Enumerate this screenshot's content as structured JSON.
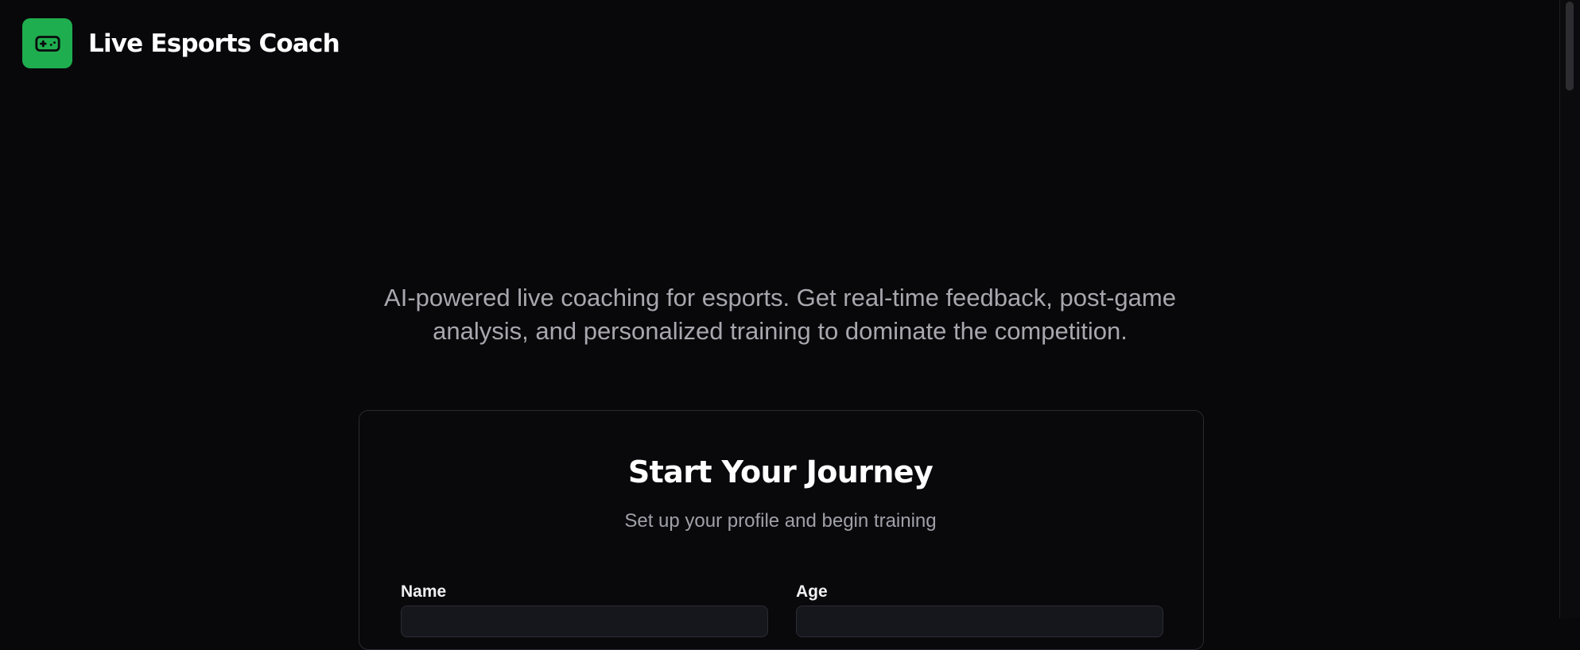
{
  "header": {
    "logo_icon": "gamepad-icon",
    "title": "Live Esports Coach",
    "accent_color": "#1fae4f"
  },
  "hero": {
    "tagline": "AI-powered live coaching for esports. Get real-time feedback, post-game analysis, and personalized training to dominate the competition."
  },
  "form": {
    "title": "Start Your Journey",
    "subtitle": "Set up your profile and begin training",
    "fields": [
      {
        "label": "Name",
        "value": ""
      },
      {
        "label": "Age",
        "value": ""
      }
    ]
  }
}
